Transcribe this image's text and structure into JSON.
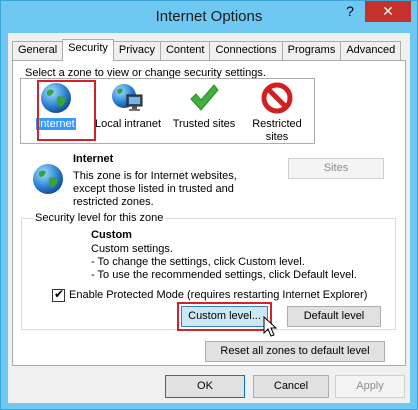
{
  "window": {
    "title": "Internet Options",
    "help_glyph": "?",
    "close_glyph": "✕"
  },
  "tabs": [
    {
      "label": "General",
      "active": false
    },
    {
      "label": "Security",
      "active": true
    },
    {
      "label": "Privacy",
      "active": false
    },
    {
      "label": "Content",
      "active": false
    },
    {
      "label": "Connections",
      "active": false
    },
    {
      "label": "Programs",
      "active": false
    },
    {
      "label": "Advanced",
      "active": false
    }
  ],
  "security": {
    "instruction": "Select a zone to view or change security settings.",
    "zones": [
      {
        "label": "Internet",
        "icon": "globe-icon",
        "selected": true
      },
      {
        "label": "Local intranet",
        "icon": "intranet-icon",
        "selected": false
      },
      {
        "label": "Trusted sites",
        "icon": "checkmark-icon",
        "selected": false
      },
      {
        "label": "Restricted sites",
        "label_line1": "Restricted",
        "label_line2": "sites",
        "icon": "no-entry-icon",
        "selected": false
      }
    ],
    "zone_info": {
      "title": "Internet",
      "desc_line1": "This zone is for Internet websites,",
      "desc_line2": "except those listed in trusted and",
      "desc_line3": "restricted zones."
    },
    "sites_button": "Sites",
    "level_group": {
      "legend": "Security level for this zone",
      "level_title": "Custom",
      "line1": "Custom settings.",
      "line2": "- To change the settings, click Custom level.",
      "line3": "- To use the recommended settings, click Default level."
    },
    "protected_mode": {
      "label": "Enable Protected Mode (requires restarting Internet Explorer)",
      "checked": true
    },
    "custom_level_button": "Custom level...",
    "default_level_button": "Default level",
    "reset_all_button": "Reset all zones to default level"
  },
  "footer": {
    "ok": "OK",
    "cancel": "Cancel",
    "apply": "Apply"
  },
  "colors": {
    "title_bar": "#6ec8f2",
    "close_button": "#c7312b",
    "highlight_red": "#d2232a",
    "selection_blue": "#3399ff",
    "focused_button": "#cce8f7"
  }
}
